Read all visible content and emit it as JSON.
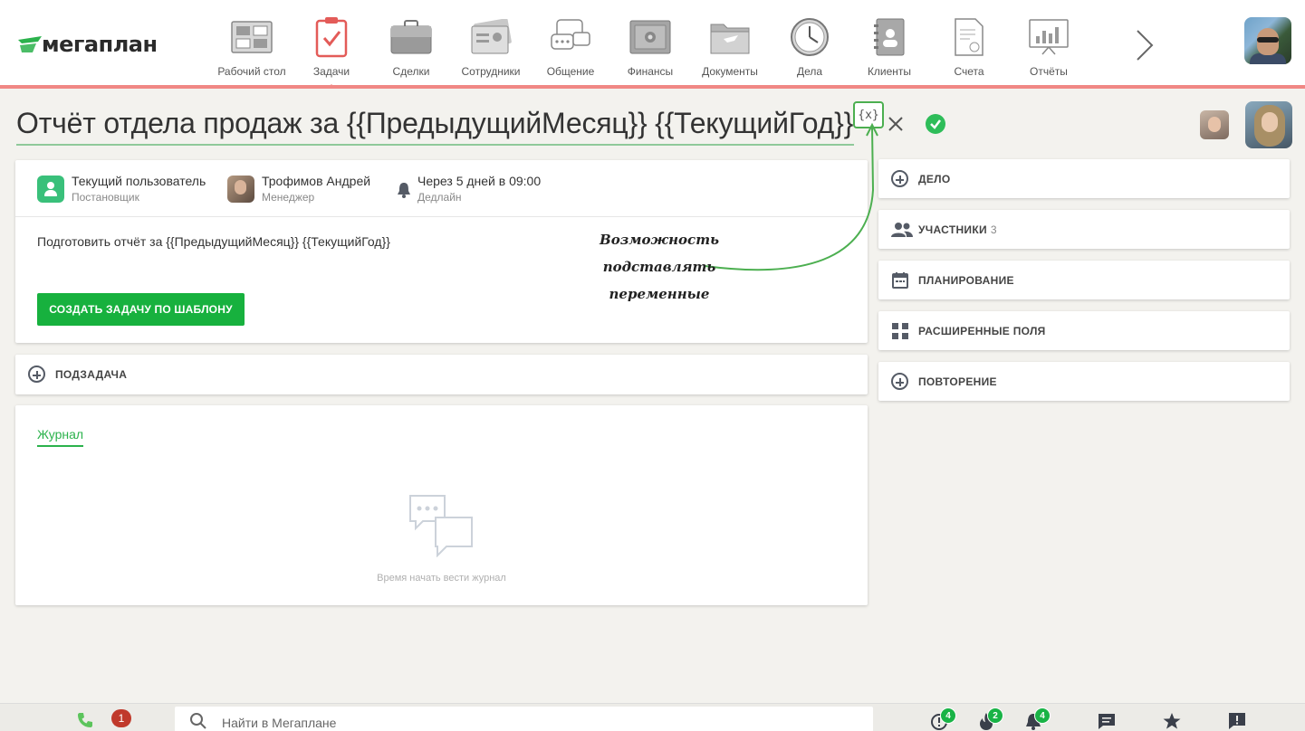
{
  "app": {
    "logo_text": "мегаплан"
  },
  "nav": {
    "items": [
      {
        "label": "Рабочий стол",
        "icon": "desktop-icon"
      },
      {
        "label": "Задачи",
        "icon": "tasks-icon",
        "active": true
      },
      {
        "label": "Сделки",
        "icon": "briefcase-icon"
      },
      {
        "label": "Сотрудники",
        "icon": "employees-icon"
      },
      {
        "label": "Общение",
        "icon": "chat-icon"
      },
      {
        "label": "Финансы",
        "icon": "safe-icon"
      },
      {
        "label": "Документы",
        "icon": "folder-icon"
      },
      {
        "label": "Дела",
        "icon": "clock-icon"
      },
      {
        "label": "Клиенты",
        "icon": "contacts-icon"
      },
      {
        "label": "Счета",
        "icon": "invoice-icon"
      },
      {
        "label": "Отчёты",
        "icon": "report-icon"
      }
    ]
  },
  "task": {
    "title": "Отчёт отдела продаж за {{ПредыдущийМесяц}} {{ТекущийГод}}",
    "var_button": "{x}",
    "participants": [
      {
        "name": "Текущий пользователь",
        "role": "Постановщик"
      },
      {
        "name": "Трофимов Андрей",
        "role": "Менеджер"
      },
      {
        "name": "Через 5 дней в 09:00",
        "role": "Дедлайн"
      }
    ],
    "description": "Подготовить отчёт за {{ПредыдущийМесяц}} {{ТекущийГод}}",
    "create_button": "СОЗДАТЬ ЗАДАЧУ ПО ШАБЛОНУ",
    "subtask_label": "ПОДЗАДАЧА"
  },
  "journal": {
    "tab": "Журнал",
    "empty_text": "Время начать вести журнал"
  },
  "sidebar": {
    "items": [
      {
        "label": "ДЕЛО",
        "icon": "plus-circle-icon"
      },
      {
        "label": "УЧАСТНИКИ",
        "count": "3",
        "icon": "people-icon"
      },
      {
        "label": "ПЛАНИРОВАНИЕ",
        "icon": "calendar-icon"
      },
      {
        "label": "РАСШИРЕННЫЕ ПОЛЯ",
        "icon": "fields-icon"
      },
      {
        "label": "ПОВТОРЕНИЕ",
        "icon": "plus-circle-icon"
      }
    ]
  },
  "annotation": {
    "line1": "Возможность подставлять",
    "line2": "переменные"
  },
  "bottombar": {
    "missed_calls": "1",
    "search_placeholder": "Найти в Мегаплане",
    "badges": {
      "alerts": "4",
      "hot": "2",
      "notifications": "4"
    }
  },
  "colors": {
    "accent_green": "#17b13e",
    "topbar_accent": "#f08784",
    "badge_red": "#c0392b"
  }
}
